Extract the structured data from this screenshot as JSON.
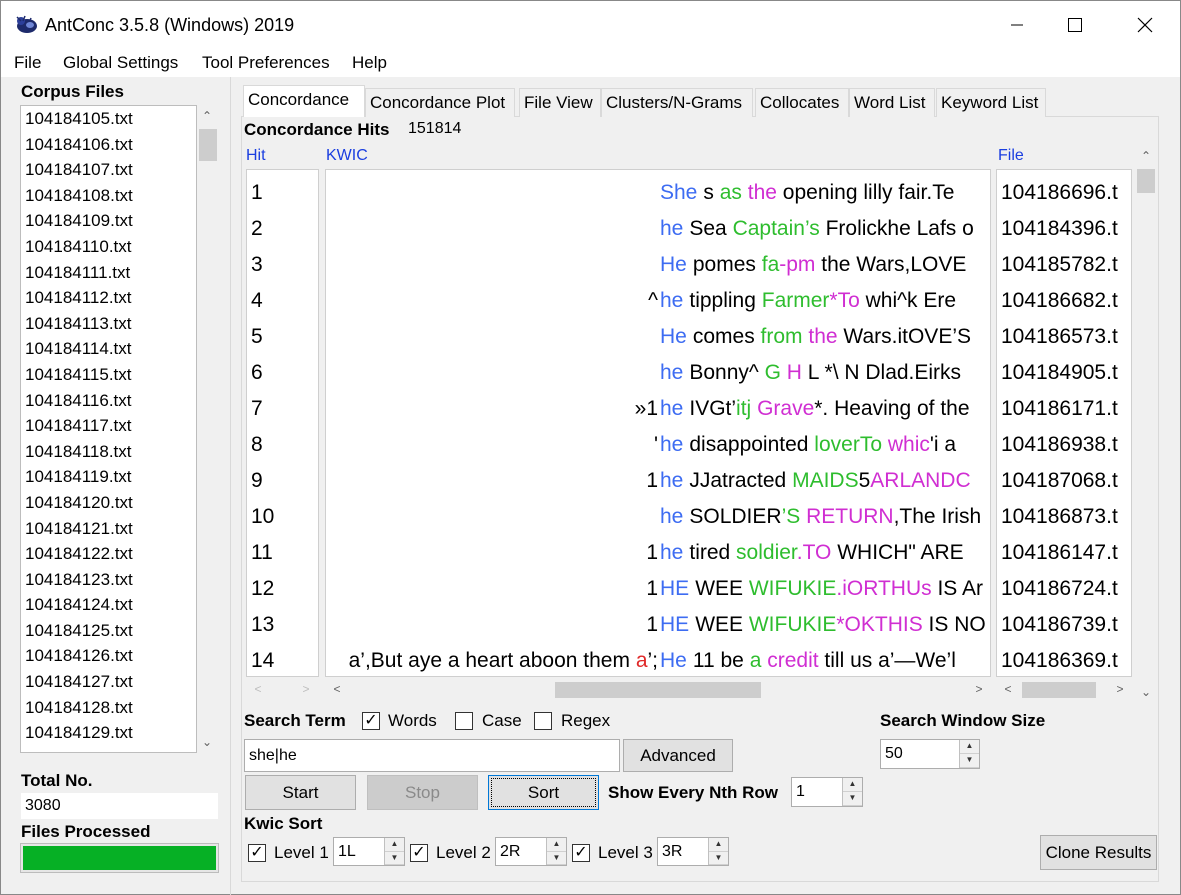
{
  "window": {
    "title": "AntConc 3.5.8 (Windows) 2019",
    "minimize_glyph": "—",
    "maximize_glyph": "☐",
    "close_glyph": "✕"
  },
  "menu": [
    "File",
    "Global Settings",
    "Tool Preferences",
    "Help"
  ],
  "sidebar": {
    "corpus_files_label": "Corpus Files",
    "files": [
      "104184105.txt",
      "104184106.txt",
      "104184107.txt",
      "104184108.txt",
      "104184109.txt",
      "104184110.txt",
      "104184111.txt",
      "104184112.txt",
      "104184113.txt",
      "104184114.txt",
      "104184115.txt",
      "104184116.txt",
      "104184117.txt",
      "104184118.txt",
      "104184119.txt",
      "104184120.txt",
      "104184121.txt",
      "104184122.txt",
      "104184123.txt",
      "104184124.txt",
      "104184125.txt",
      "104184126.txt",
      "104184127.txt",
      "104184128.txt",
      "104184129.txt"
    ],
    "total_label": "Total No.",
    "total_value": "3080",
    "files_processed_label": "Files Processed",
    "progress_fraction": 1.0,
    "progress_color": "#06b025"
  },
  "tabs": [
    "Concordance",
    "Concordance Plot",
    "File View",
    "Clusters/N-Grams",
    "Collocates",
    "Word List",
    "Keyword List"
  ],
  "active_tab": "Concordance",
  "concordance": {
    "hits_label": "Concordance Hits",
    "hits_value": "151814",
    "col_hit": "Hit",
    "col_kwic": "KWIC",
    "col_file": "File",
    "rows": [
      {
        "hit": "1",
        "left": [],
        "node": "She",
        "right": [
          [
            "s ",
            ""
          ],
          [
            "as",
            "green"
          ],
          [
            " ",
            ""
          ],
          [
            "the",
            "pink"
          ],
          [
            " opening lilly fair.Te",
            ""
          ]
        ],
        "file": "104186696.t"
      },
      {
        "hit": "2",
        "left": [],
        "node": "he",
        "right": [
          [
            "Sea ",
            ""
          ],
          [
            "Captain’s",
            "green"
          ],
          [
            " Frolickhe Lafs o",
            ""
          ]
        ],
        "file": "104184396.t"
      },
      {
        "hit": "3",
        "left": [],
        "node": "He",
        "right": [
          [
            "pomes ",
            ""
          ],
          [
            "fa",
            "green"
          ],
          [
            "-pm",
            "pink"
          ],
          [
            " the Wars,LOVE",
            ""
          ]
        ],
        "file": "104185782.t"
      },
      {
        "hit": "4",
        "left": [
          [
            "^",
            ""
          ]
        ],
        "node": "he",
        "right": [
          [
            "tippling ",
            ""
          ],
          [
            "Farmer",
            "green"
          ],
          [
            "*To",
            "pink"
          ],
          [
            " whi^k Ere",
            ""
          ]
        ],
        "file": "104186682.t"
      },
      {
        "hit": "5",
        "left": [],
        "node": "He",
        "right": [
          [
            "comes ",
            ""
          ],
          [
            "from",
            "green"
          ],
          [
            " ",
            ""
          ],
          [
            "the",
            "pink"
          ],
          [
            " Wars.itOVE’S",
            ""
          ]
        ],
        "file": "104186573.t"
      },
      {
        "hit": "6",
        "left": [],
        "node": "he",
        "right": [
          [
            "Bonny^ ",
            ""
          ],
          [
            "G",
            "green"
          ],
          [
            " ",
            ""
          ],
          [
            "H",
            "pink"
          ],
          [
            " L *\\ N Dlad.Eirks",
            ""
          ]
        ],
        "file": "104184905.t"
      },
      {
        "hit": "7",
        "left": [
          [
            "»1",
            ""
          ]
        ],
        "node": "he",
        "right": [
          [
            "IVGt’",
            ""
          ],
          [
            "itj",
            "green"
          ],
          [
            " ",
            ""
          ],
          [
            "Grave",
            "pink"
          ],
          [
            "*. Heaving of the",
            ""
          ]
        ],
        "file": "104186171.t"
      },
      {
        "hit": "8",
        "left": [
          [
            "'",
            ""
          ]
        ],
        "node": "he",
        "right": [
          [
            "disappointed ",
            ""
          ],
          [
            "loverTo",
            "green"
          ],
          [
            " ",
            ""
          ],
          [
            "whic",
            "pink"
          ],
          [
            "'i a",
            ""
          ]
        ],
        "file": "104186938.t"
      },
      {
        "hit": "9",
        "left": [
          [
            "1",
            ""
          ]
        ],
        "node": "he",
        "right": [
          [
            "JJatracted ",
            ""
          ],
          [
            "MAIDS",
            "green"
          ],
          [
            "5",
            ""
          ],
          [
            "ARLANDC",
            "pink"
          ]
        ],
        "file": "104187068.t"
      },
      {
        "hit": "10",
        "left": [],
        "node": "he",
        "right": [
          [
            "SOLDIER",
            ""
          ],
          [
            "’S",
            "green"
          ],
          [
            " ",
            ""
          ],
          [
            "RETURN",
            "pink"
          ],
          [
            ",The Irish",
            ""
          ]
        ],
        "file": "104186873.t"
      },
      {
        "hit": "11",
        "left": [
          [
            "1",
            ""
          ]
        ],
        "node": "he",
        "right": [
          [
            "tired ",
            ""
          ],
          [
            "soldier",
            "green"
          ],
          [
            ".TO",
            "pink"
          ],
          [
            " WHICH\" ARE",
            ""
          ]
        ],
        "file": "104186147.t"
      },
      {
        "hit": "12",
        "left": [
          [
            "1",
            ""
          ]
        ],
        "node": "HE",
        "right": [
          [
            "WEE ",
            ""
          ],
          [
            "WIFUKIE",
            "green"
          ],
          [
            ".iORTHUs",
            "pink"
          ],
          [
            " IS Ar",
            ""
          ]
        ],
        "file": "104186724.t"
      },
      {
        "hit": "13",
        "left": [
          [
            "1",
            ""
          ]
        ],
        "node": "HE",
        "right": [
          [
            "WEE ",
            ""
          ],
          [
            "WIFUKIE",
            "green"
          ],
          [
            "*OKTHIS",
            "pink"
          ],
          [
            " IS NO",
            ""
          ]
        ],
        "file": "104186739.t"
      },
      {
        "hit": "14",
        "left": [
          [
            "a’,But aye a heart aboon them ",
            ""
          ],
          [
            "a",
            "red"
          ],
          [
            "’;",
            ""
          ]
        ],
        "node": "He",
        "right": [
          [
            "11 be ",
            ""
          ],
          [
            "a",
            "green"
          ],
          [
            " ",
            ""
          ],
          [
            "credit",
            "pink"
          ],
          [
            " till us a’—We’l",
            ""
          ]
        ],
        "file": "104186369.t"
      }
    ]
  },
  "search": {
    "term_label": "Search Term",
    "words_label": "Words",
    "words_checked": true,
    "case_label": "Case",
    "case_checked": false,
    "regex_label": "Regex",
    "regex_checked": false,
    "query": "she|he",
    "advanced_label": "Advanced",
    "window_size_label": "Search Window Size",
    "window_size_value": "50",
    "start_label": "Start",
    "stop_label": "Stop",
    "sort_label": "Sort",
    "nth_row_label": "Show Every Nth Row",
    "nth_row_value": "1"
  },
  "kwic_sort": {
    "label": "Kwic Sort",
    "levels": [
      {
        "label": "Level 1",
        "value": "1L",
        "checked": true
      },
      {
        "label": "Level 2",
        "value": "2R",
        "checked": true
      },
      {
        "label": "Level 3",
        "value": "3R",
        "checked": true
      }
    ]
  },
  "clone_label": "Clone Results"
}
